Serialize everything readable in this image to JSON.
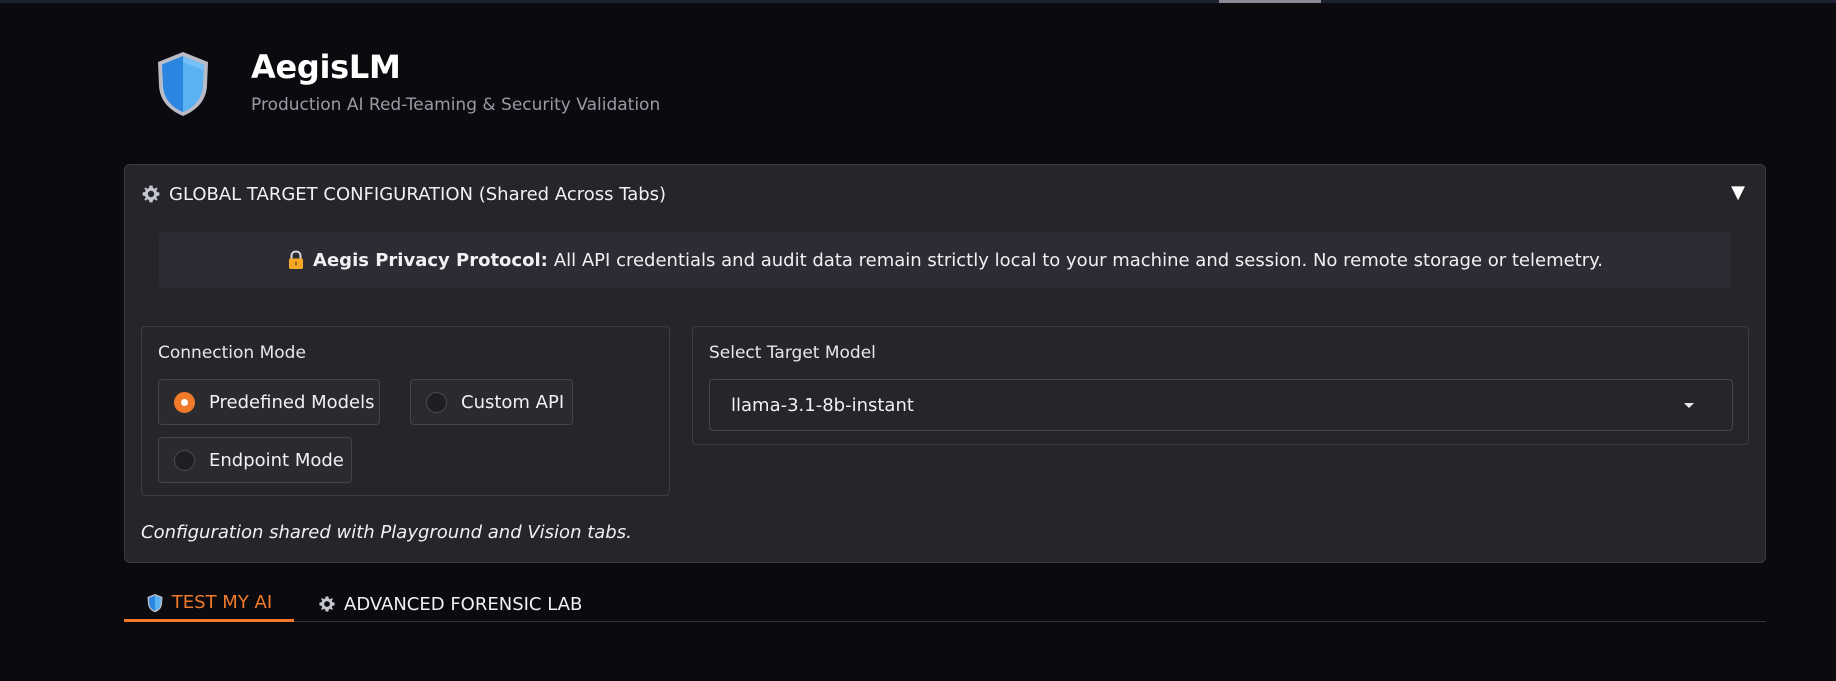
{
  "app": {
    "title": "AegisLM",
    "subtitle": "Production AI Red-Teaming & Security Validation",
    "logo_icon": "shield-icon"
  },
  "config": {
    "title": "GLOBAL TARGET CONFIGURATION (Shared Across Tabs)",
    "title_icon": "gear-icon",
    "collapse_glyph": "▼",
    "privacy": {
      "icon": "lock-icon",
      "label": "Aegis Privacy Protocol:",
      "text": "All API credentials and audit data remain strictly local to your machine and session. No remote storage or telemetry."
    },
    "connection_mode": {
      "label": "Connection Mode",
      "options": [
        "Predefined Models",
        "Custom API",
        "Endpoint Mode"
      ],
      "selected": "Predefined Models"
    },
    "target_model": {
      "label": "Select Target Model",
      "value": "llama-3.1-8b-instant"
    },
    "note": "Configuration shared with Playground and Vision tabs."
  },
  "tabs": [
    {
      "label": "TEST MY AI",
      "icon": "shield-icon",
      "active": true
    },
    {
      "label": "ADVANCED FORENSIC LAB",
      "icon": "gear-icon",
      "active": false
    }
  ],
  "colors": {
    "background": "#0b0b0f",
    "panel": "#26262a",
    "accent": "#f07a2a",
    "shield_light": "#5ab2f2",
    "shield_dark": "#2a86e0"
  }
}
